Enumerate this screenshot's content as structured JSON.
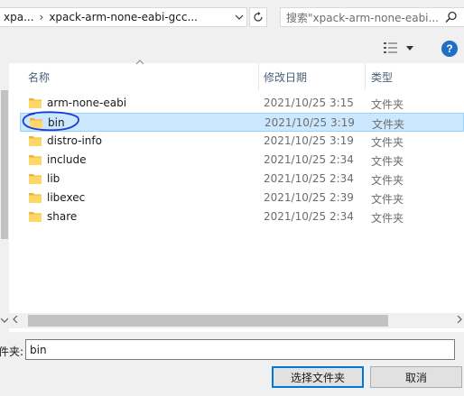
{
  "address": {
    "crumb": "xpa...",
    "separator": "›",
    "path": "xpack-arm-none-eabi-gcc..."
  },
  "search": {
    "placeholder": "搜索\"xpack-arm-none-eabi..."
  },
  "columns": {
    "name": "名称",
    "date": "修改日期",
    "type": "类型"
  },
  "files": [
    {
      "name": "arm-none-eabi",
      "date": "2021/10/25 3:15",
      "type": "文件夹"
    },
    {
      "name": "bin",
      "date": "2021/10/25 3:19",
      "type": "文件夹"
    },
    {
      "name": "distro-info",
      "date": "2021/10/25 3:19",
      "type": "文件夹"
    },
    {
      "name": "include",
      "date": "2021/10/25 2:34",
      "type": "文件夹"
    },
    {
      "name": "lib",
      "date": "2021/10/25 2:34",
      "type": "文件夹"
    },
    {
      "name": "libexec",
      "date": "2021/10/25 2:39",
      "type": "文件夹"
    },
    {
      "name": "share",
      "date": "2021/10/25 2:34",
      "type": "文件夹"
    }
  ],
  "folder_label": "文件夹:",
  "folder_value": "bin",
  "buttons": {
    "ok": "选择文件夹",
    "cancel": "取消"
  },
  "help_glyph": "?",
  "colors": {
    "selection": "#cce8ff",
    "folder": "#ffd766",
    "help": "#1f6fc5",
    "annotation": "#1a3ad8"
  }
}
